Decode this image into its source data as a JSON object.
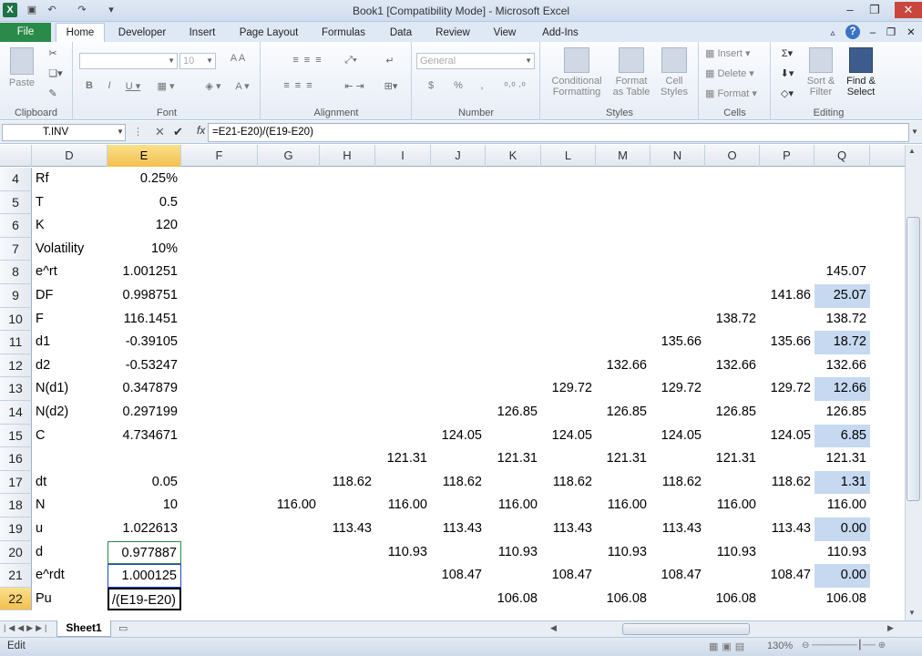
{
  "window": {
    "title": "Book1  [Compatibility Mode]  -  Microsoft Excel"
  },
  "tabs": [
    "File",
    "Home",
    "Developer",
    "Insert",
    "Page Layout",
    "Formulas",
    "Data",
    "Review",
    "View",
    "Add-Ins"
  ],
  "ribbon": {
    "clipboard": {
      "label": "Clipboard",
      "paste": "Paste"
    },
    "font": {
      "label": "Font",
      "size": "10"
    },
    "alignment": {
      "label": "Alignment"
    },
    "number": {
      "label": "Number",
      "format": "General",
      "currency": "$",
      "percent": "%"
    },
    "styles": {
      "label": "Styles",
      "conditional": "Conditional",
      "formatting": "Formatting",
      "format_as": "Format",
      "as_table": "as Table",
      "cell": "Cell",
      "cell_styles": "Styles"
    },
    "cells": {
      "label": "Cells",
      "insert": "Insert",
      "delete": "Delete",
      "format": "Format"
    },
    "editing": {
      "label": "Editing",
      "sort": "Sort &",
      "filter": "Filter",
      "find": "Find &",
      "select": "Select"
    }
  },
  "formula_bar": {
    "name_box": "T.INV",
    "fx": "fx",
    "formula": "=E21-E20)/(E19-E20)"
  },
  "columns": [
    "D",
    "E",
    "F",
    "G",
    "H",
    "I",
    "J",
    "K",
    "L",
    "M",
    "N",
    "O",
    "P",
    "Q"
  ],
  "rows": [
    "4",
    "5",
    "6",
    "7",
    "8",
    "9",
    "10",
    "11",
    "12",
    "13",
    "14",
    "15",
    "16",
    "17",
    "18",
    "19",
    "20",
    "21",
    "22"
  ],
  "labels": {
    "4": "Rf",
    "5": "T",
    "6": "K",
    "7": "Volatility",
    "8": "e^rt",
    "9": "DF",
    "10": "F",
    "11": "d1",
    "12": "d2",
    "13": "N(d1)",
    "14": "N(d2)",
    "15": "C",
    "17": "dt",
    "18": "N",
    "19": "u",
    "20": "d",
    "21": "e^rdt",
    "22": "Pu"
  },
  "evalues": {
    "4": "0.25%",
    "5": "0.5",
    "6": "120",
    "7": "10%",
    "8": "1.001251",
    "9": "0.998751",
    "10": "116.1451",
    "11": "-0.39105",
    "12": "-0.53247",
    "13": "0.347879",
    "14": "0.297199",
    "15": "4.734671",
    "17": "0.05",
    "18": "10",
    "19": "1.022613",
    "20": "0.977887",
    "21": "1.000125",
    "22": "/(E19-E20)"
  },
  "tree": {
    "8": {
      "Q": "145.07"
    },
    "9": {
      "P": "141.86",
      "Q": "25.07"
    },
    "10": {
      "O": "138.72",
      "Q": "138.72"
    },
    "11": {
      "N": "135.66",
      "P": "135.66",
      "Q": "18.72"
    },
    "12": {
      "M": "132.66",
      "O": "132.66",
      "Q": "132.66"
    },
    "13": {
      "L": "129.72",
      "N": "129.72",
      "P": "129.72",
      "Q": "12.66"
    },
    "14": {
      "K": "126.85",
      "M": "126.85",
      "O": "126.85",
      "Q": "126.85"
    },
    "15": {
      "J": "124.05",
      "L": "124.05",
      "N": "124.05",
      "P": "124.05",
      "Q": "6.85"
    },
    "16": {
      "I": "121.31",
      "K": "121.31",
      "M": "121.31",
      "O": "121.31",
      "Q": "121.31"
    },
    "17": {
      "H": "118.62",
      "J": "118.62",
      "L": "118.62",
      "N": "118.62",
      "P": "118.62",
      "Q": "1.31"
    },
    "18": {
      "G": "116.00",
      "I": "116.00",
      "K": "116.00",
      "M": "116.00",
      "O": "116.00",
      "Q": "116.00"
    },
    "19": {
      "H": "113.43",
      "J": "113.43",
      "L": "113.43",
      "N": "113.43",
      "P": "113.43",
      "Q": "0.00"
    },
    "20": {
      "I": "110.93",
      "K": "110.93",
      "M": "110.93",
      "O": "110.93",
      "Q": "110.93"
    },
    "21": {
      "J": "108.47",
      "L": "108.47",
      "N": "108.47",
      "P": "108.47",
      "Q": "0.00"
    },
    "22": {
      "K": "106.08",
      "M": "106.08",
      "O": "106.08",
      "Q": "106.08"
    }
  },
  "highlight_rows_q": [
    "9",
    "11",
    "13",
    "15",
    "17",
    "19",
    "21"
  ],
  "sheet": {
    "tab": "Sheet1"
  },
  "status": {
    "mode": "Edit",
    "zoom": "130%"
  },
  "colors": {
    "highlight": "#c6d9f0",
    "selected_header": "#f3c04f",
    "file_tab": "#2a8a4a"
  }
}
